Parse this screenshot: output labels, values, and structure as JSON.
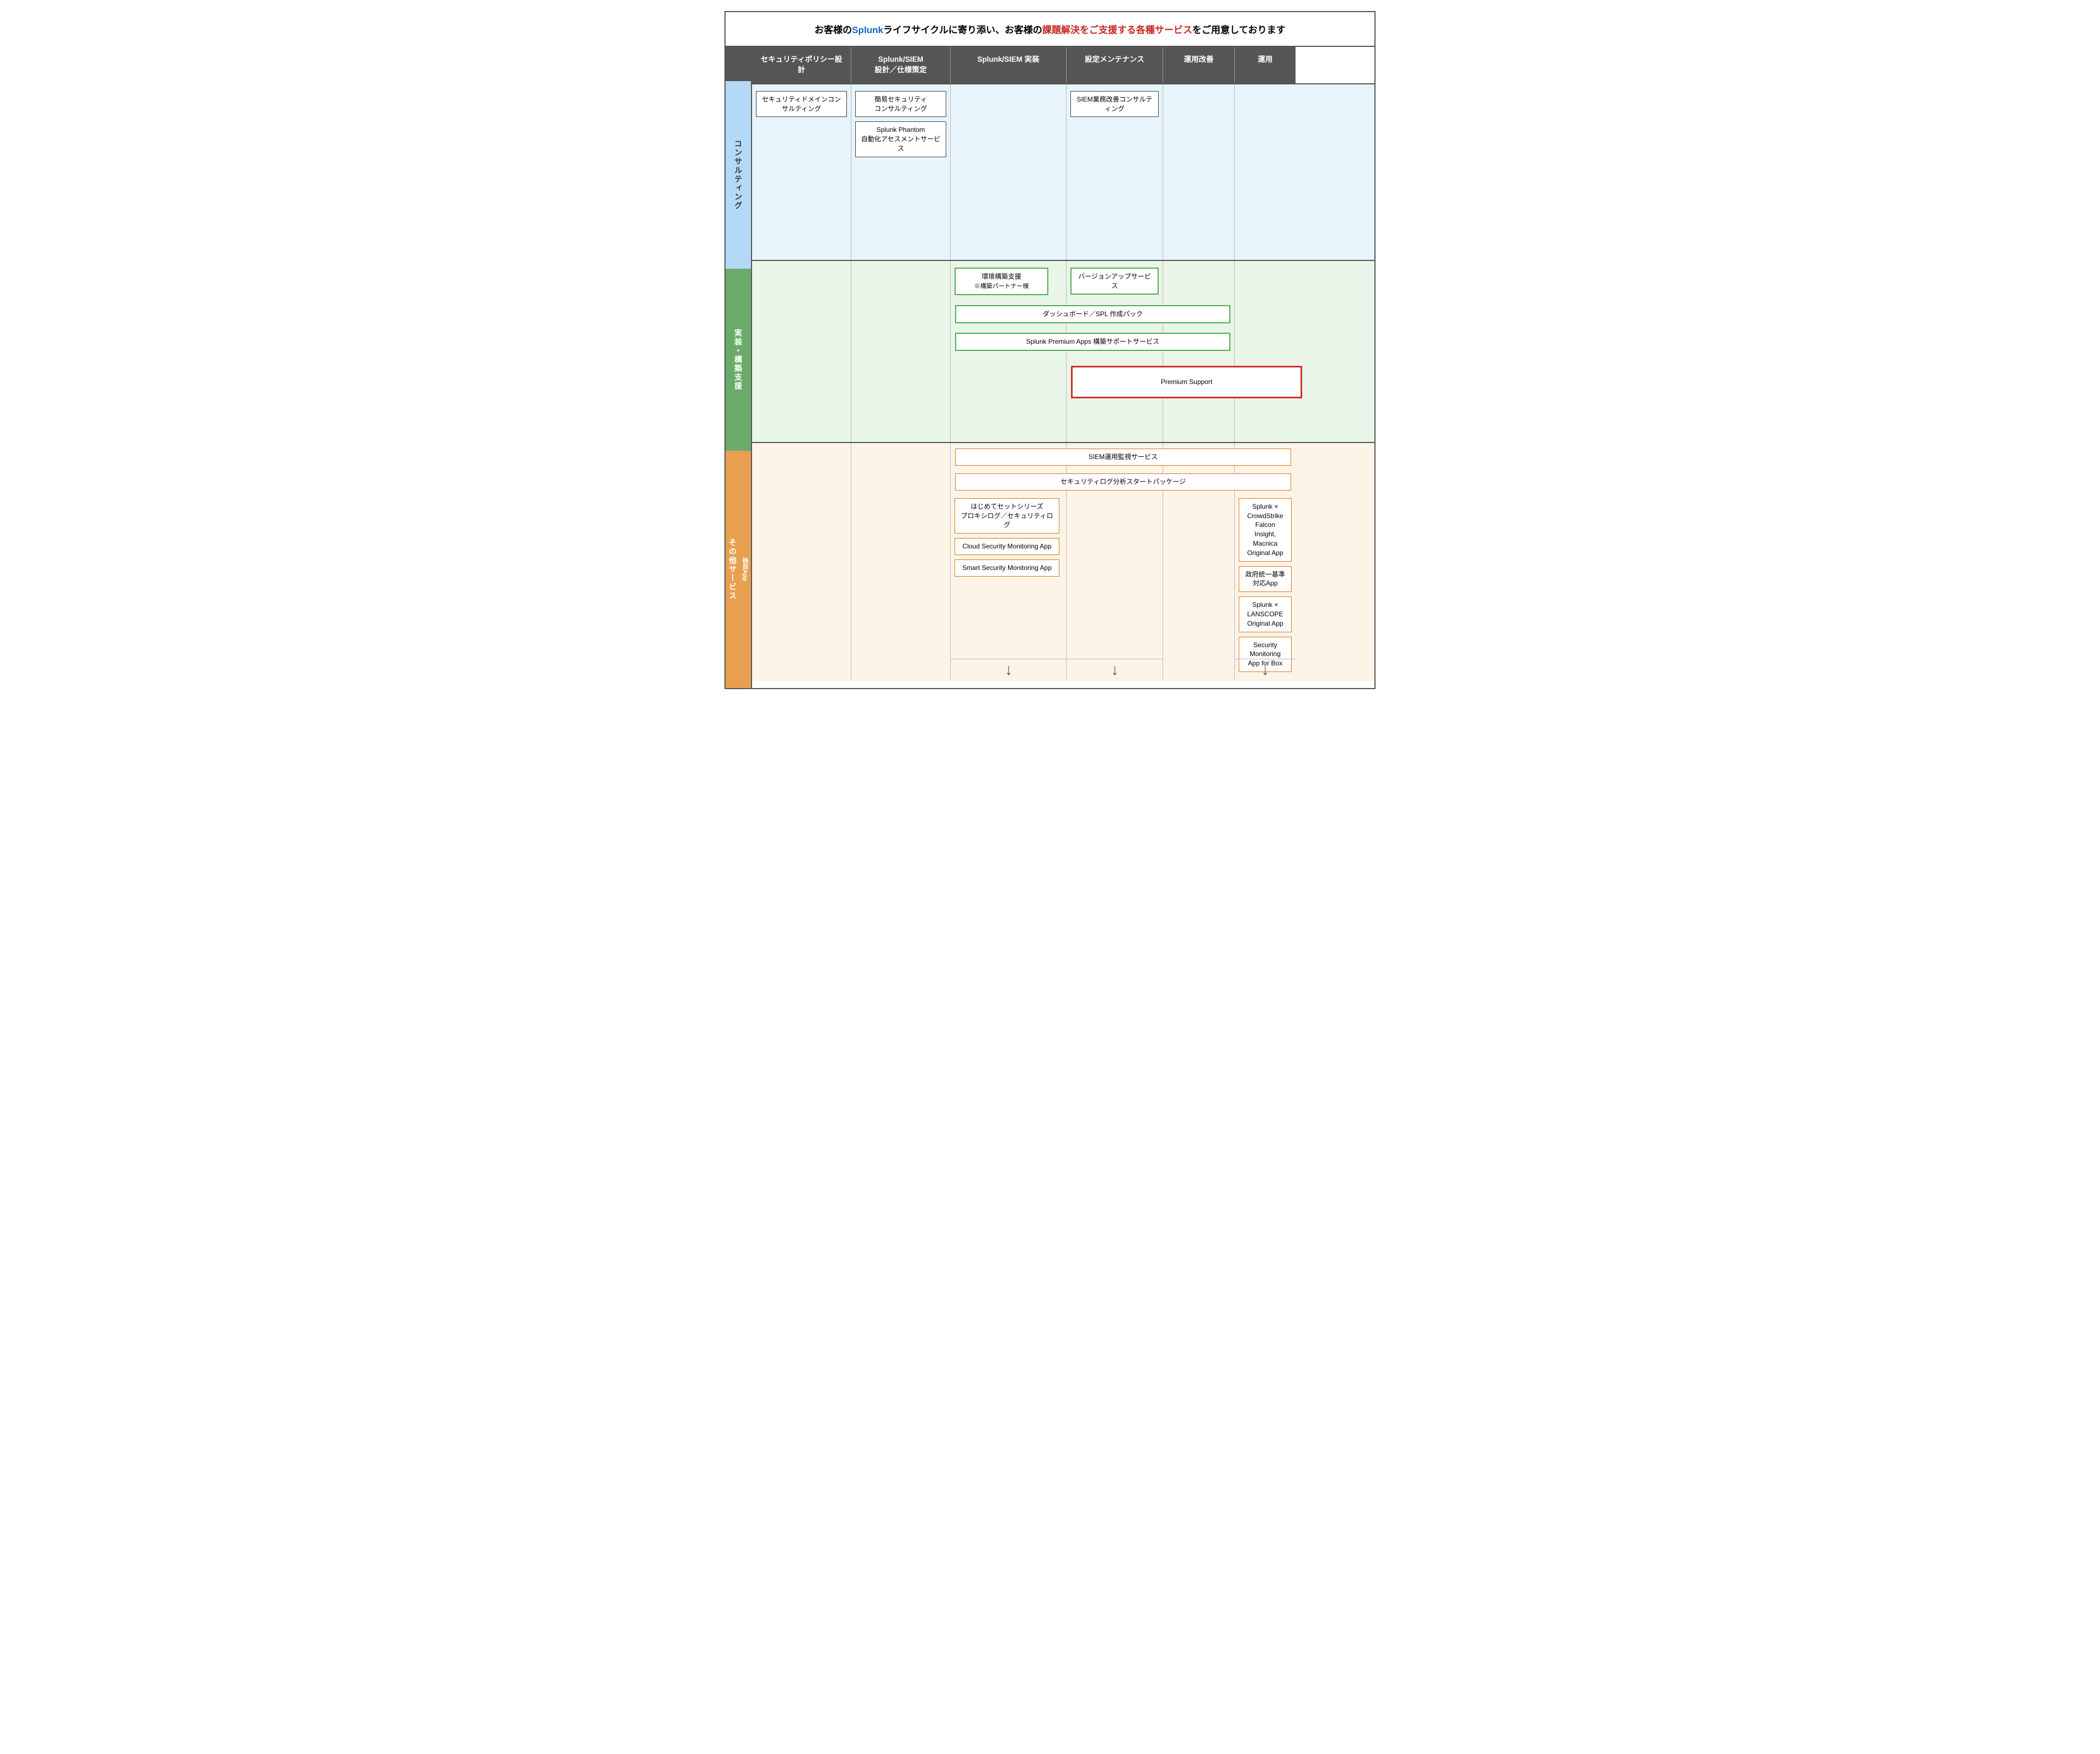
{
  "banner": {
    "prefix": "お客様の",
    "blue1": "Splunk",
    "middle": "ライフサイクルに寄り添い、お客様の",
    "red1": "課題解決をご支援する各種サービス",
    "suffix": "をご用意しております"
  },
  "col_headers": [
    "セキュリティポリシー設計",
    "Splunk/SIEM\n設計／仕様策定",
    "Splunk/SIEM 実装",
    "設定メンテナンス",
    "運用改善",
    "運用"
  ],
  "left_labels": [
    {
      "id": "consulting",
      "text": "コンサルティング"
    },
    {
      "id": "jisso",
      "text": "実装・構築支援"
    },
    {
      "id": "sonota",
      "text": "その他サービス",
      "sub": "独自App"
    }
  ],
  "consulting_services": {
    "col1": [
      "セキュリティドメインコンサルティング"
    ],
    "col2": [
      "簡易セキュリティ\nコンサルティング",
      "Splunk Phantom\n自動化アセスメントサービス"
    ],
    "col4": [
      "SIEM業務改善コンサルティング"
    ]
  },
  "jisso_services": {
    "col3_small": "環境構築支援\n※構築パートナー様",
    "col4_small": "バージョンアップサービス",
    "col3_wide_dashboard": "ダッシュボード／SPL 作成パック",
    "col3_wide_premium_apps": "Splunk Premium Apps 構築サポートサービス",
    "col4_premium_support": "Premium Support"
  },
  "sonota_services": {
    "col3_wide_siem": "SIEM運用監視サービス",
    "col3_wide_security_log": "セキュリティログ分析スタートパッケージ",
    "col3_hajimete": "はじめてセットシリーズ\nプロキシログ／セキュリティログ",
    "col3_cloud": "Cloud Security Monitoring App",
    "col3_smart": "Smart Security Monitoring App",
    "col6_crowdstrike": "Splunk × CrowdStrike Falcon\nInsight, Macnica Original App",
    "col6_seifutouichi": "政府統一基準対応App",
    "col6_lanscope": "Splunk × LANSCOPE\nOriginal App",
    "col6_box": "Security Monitoring\nApp for Box"
  },
  "arrows": {
    "symbol": "↓"
  }
}
